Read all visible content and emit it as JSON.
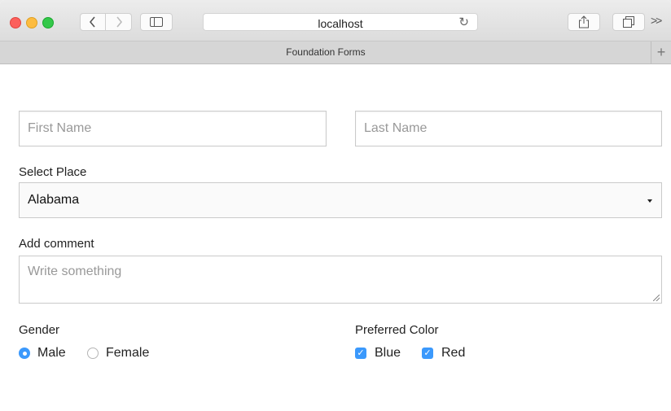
{
  "browser": {
    "url": "localhost",
    "tab_title": "Foundation Forms",
    "more_label": ">>"
  },
  "form": {
    "first_name": {
      "placeholder": "First Name",
      "value": ""
    },
    "last_name": {
      "placeholder": "Last Name",
      "value": ""
    },
    "place": {
      "label": "Select Place",
      "selected": "Alabama"
    },
    "comment": {
      "label": "Add comment",
      "placeholder": "Write something"
    },
    "gender": {
      "label": "Gender",
      "options": [
        {
          "label": "Male",
          "selected": true
        },
        {
          "label": "Female",
          "selected": false
        }
      ]
    },
    "color": {
      "label": "Preferred Color",
      "options": [
        {
          "label": "Blue",
          "checked": true
        },
        {
          "label": "Red",
          "checked": true
        }
      ]
    }
  },
  "colors": {
    "accent": "#3b99fc",
    "border": "#cacaca"
  },
  "icons": {
    "back": "chevron-left-icon",
    "forward": "chevron-right-icon",
    "sidebar": "sidebar-icon",
    "reload": "reload-icon",
    "share": "share-icon",
    "tabs": "tabs-icon",
    "new_tab": "plus-icon"
  }
}
